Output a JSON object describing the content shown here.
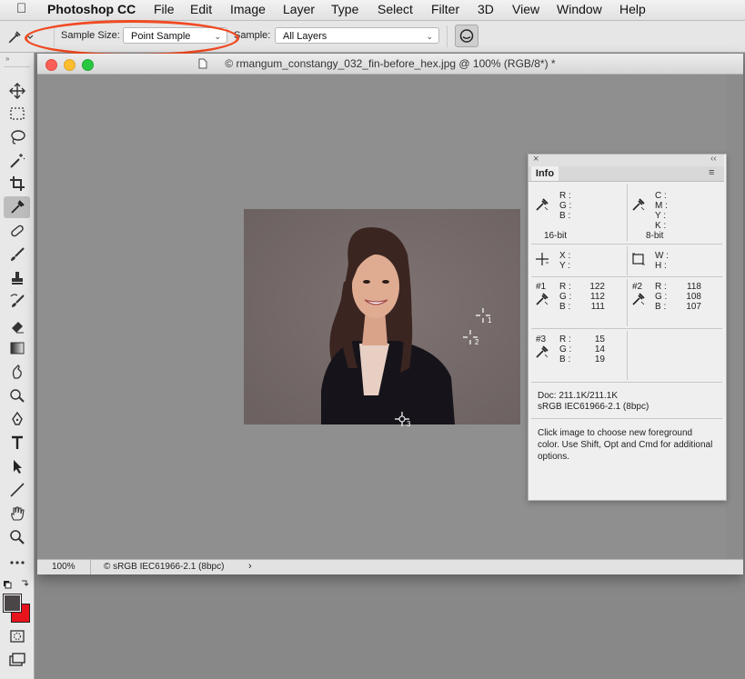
{
  "menubar": {
    "app_name": "Photoshop CC",
    "items": [
      "File",
      "Edit",
      "Image",
      "Layer",
      "Type",
      "Select",
      "Filter",
      "3D",
      "View",
      "Window",
      "Help"
    ]
  },
  "options_bar": {
    "sample_size_label": "Sample Size:",
    "sample_size_value": "Point Sample",
    "sample_label": "Sample:",
    "sample_value": "All Layers"
  },
  "document": {
    "title": "© rmangum_constangy_032_fin-before_hex.jpg @ 100% (RGB/8*) *",
    "zoom": "100%",
    "profile": "© sRGB IEC61966-2.1 (8bpc)",
    "samplers": [
      "1",
      "2",
      "3"
    ]
  },
  "info_panel": {
    "tab": "Info",
    "rgb_labels": [
      "R :",
      "G :",
      "B :"
    ],
    "cmyk_labels": [
      "C :",
      "M :",
      "Y :",
      "K :"
    ],
    "bit_left": "16-bit",
    "bit_right": "8-bit",
    "xy_labels": [
      "X :",
      "Y :"
    ],
    "wh_labels": [
      "W :",
      "H :"
    ],
    "sampler1": {
      "tag": "#1",
      "R": "122",
      "G": "112",
      "B": "111"
    },
    "sampler2": {
      "tag": "#2",
      "R": "118",
      "G": "108",
      "B": "107"
    },
    "sampler3": {
      "tag": "#3",
      "R": "15",
      "G": "14",
      "B": "19"
    },
    "doc_size": "Doc: 211.1K/211.1K",
    "doc_profile": "sRGB IEC61966-2.1 (8bpc)",
    "hint": "Click image to choose new foreground color.  Use Shift, Opt and Cmd for additional options."
  },
  "colors": {
    "foreground": "#4a4546",
    "background": "#e8141b",
    "highlight_ring": "#f04a22"
  }
}
